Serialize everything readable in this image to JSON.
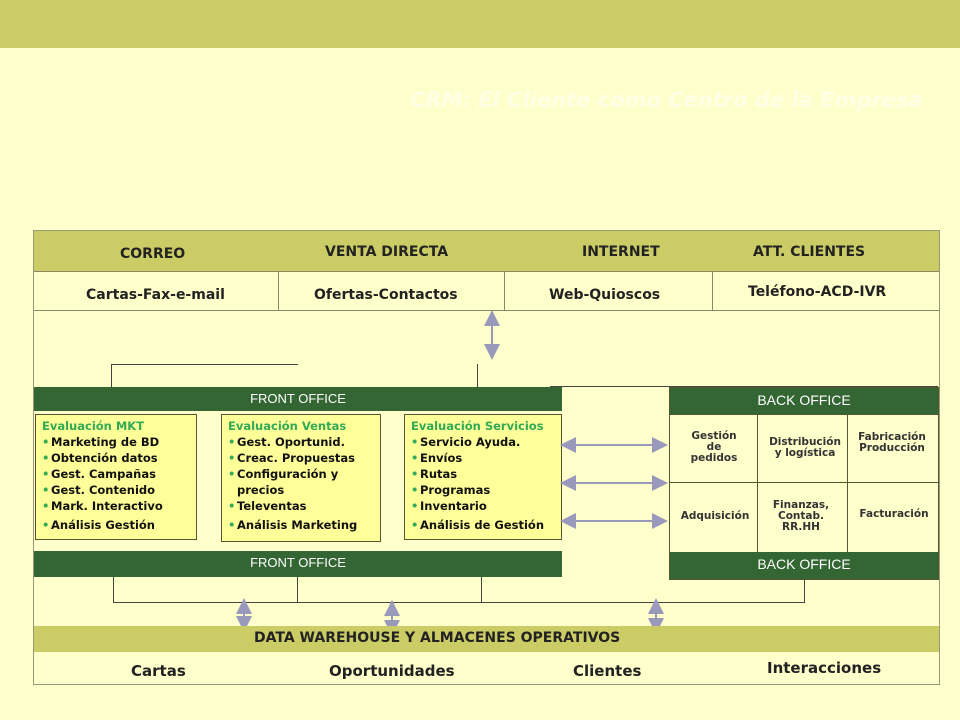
{
  "title": "CRM: El Cliente como Centro de la Empresa",
  "channels": {
    "correo": "CORREO",
    "venta_directa": "VENTA DIRECTA",
    "internet": "INTERNET",
    "att_clientes": "ATT. CLIENTES"
  },
  "channel_details": {
    "correo": "Cartas-Fax-e-mail",
    "venta_directa": "Ofertas-Contactos",
    "internet": "Web-Quioscos",
    "att_clientes": "Teléfono-ACD-IVR"
  },
  "front_office": {
    "top_label": "FRONT OFFICE",
    "bottom_label": "FRONT OFFICE",
    "columns": [
      {
        "heading": "Evaluación MKT",
        "items": [
          "Marketing de BD",
          "Obtención datos",
          "Gest. Campañas",
          "Gest. Contenido",
          "Mark. Interactivo",
          "Análisis Gestión"
        ]
      },
      {
        "heading": "Evaluación Ventas",
        "items": [
          "Gest. Oportunid.",
          "Creac. Propuestas",
          "Configuración y precios",
          "Televentas",
          "Análisis Marketing"
        ]
      },
      {
        "heading": "Evaluación Servicios",
        "items": [
          "Servicio Ayuda.",
          "Envíos",
          "Rutas",
          "Programas",
          "Inventario",
          "Análisis de Gestión"
        ]
      }
    ]
  },
  "back_office": {
    "top_label": "BACK OFFICE",
    "bottom_label": "BACK OFFICE",
    "cells": {
      "gestion": "Gestión de pedidos",
      "distribucion": "Distribución y logística",
      "fabricacion": "Fabricación Producción",
      "adquisicion": "Adquisición",
      "finanzas": "Finanzas, Contab. RR.HH",
      "facturacion": "Facturación"
    }
  },
  "data_warehouse": {
    "label": "DATA WAREHOUSE Y ALMACENES OPERATIVOS",
    "items": {
      "cartas": "Cartas",
      "oportunidades": "Oportunidades",
      "clientes": "Clientes",
      "interacciones": "Interacciones"
    }
  }
}
